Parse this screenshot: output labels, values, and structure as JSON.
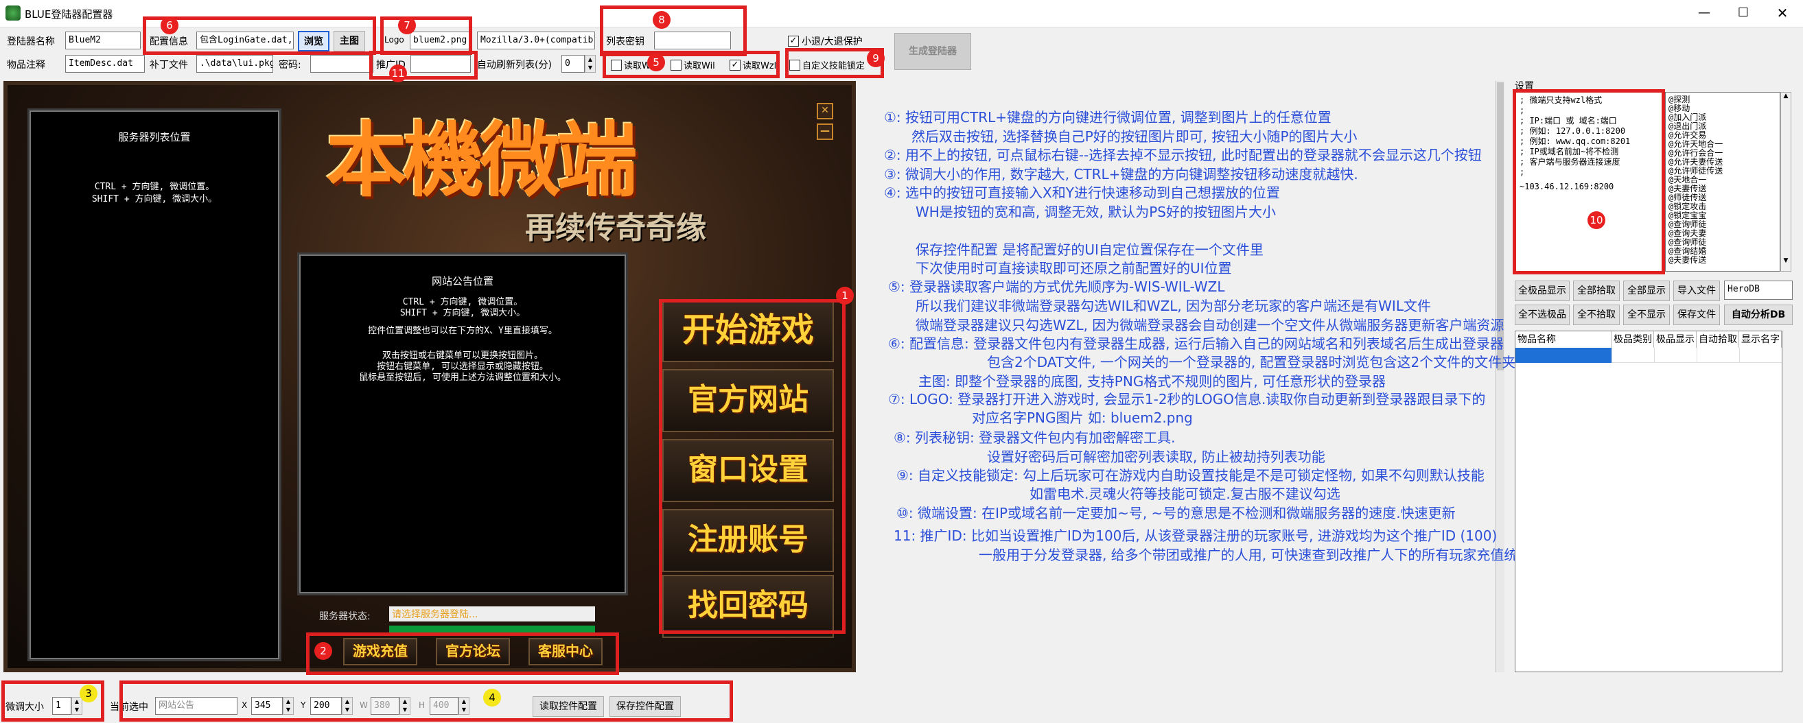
{
  "window": {
    "title": "BLUE登陆器配置器"
  },
  "toolbar": {
    "launcher_name_label": "登陆器名称",
    "launcher_name_value": "BlueM2",
    "config_info_label": "配置信息",
    "config_info_value": "包含LoginGate.dat,",
    "browse_label": "浏览",
    "main_image_label": "主图",
    "logo_label": "Logo",
    "logo_value": "bluem2.png",
    "useragent_value": "Mozilla/3.0+(compatible",
    "list_key_label": "列表密钥",
    "list_key_value": "",
    "small_retreat_label": "小退/大退保护",
    "generate_label": "生成登陆器",
    "item_note_label": "物品注释",
    "item_note_value": "ItemDesc.dat",
    "patch_file_label": "补丁文件",
    "patch_file_value": ".\\data\\lui.pkg",
    "password_label": "密码:",
    "password_value": "",
    "promo_id_label": "推广ID",
    "promo_id_value": "",
    "auto_refresh_label": "自动刷新列表(分)",
    "auto_refresh_value": "0",
    "read_wis_label": "读取Wis",
    "read_wil_label": "读取Wil",
    "read_wzl_label": "读取Wzl",
    "custom_skill_lock_label": "自定义技能锁定"
  },
  "badges": {
    "b1": "1",
    "b2": "2",
    "b3": "3",
    "b4": "4",
    "b5": "5",
    "b6": "6",
    "b7": "7",
    "b8": "8",
    "b9": "9",
    "b10": "10",
    "b11": "11"
  },
  "preview": {
    "logo_main": "本機微端",
    "logo_sub": "再续传奇奇缘",
    "server_list_title": "服务器列表位置",
    "server_list_hint1": "CTRL + 方向键, 微调位置。",
    "server_list_hint2": "SHIFT + 方向键,  微调大小。",
    "notice_title": "网站公告位置",
    "notice_hint1": "CTRL + 方向键, 微调位置。",
    "notice_hint2": "SHIFT + 方向键,  微调大小。",
    "notice_hint3": "控件位置调整也可以在下方的X、Y里直接填写。",
    "notice_hint4": "双击按钮或右键菜单可以更换按钮图片。",
    "notice_hint5": "按钮右键菜单, 可以选择显示或隐藏按钮。",
    "notice_hint6": "鼠标悬至按钮后, 可使用上述方法调整位置和大小。",
    "btn_start": "开始游戏",
    "btn_website": "官方网站",
    "btn_window": "窗口设置",
    "btn_register": "注册账号",
    "btn_recover": "找回密码",
    "server_status_label": "服务器状态:",
    "server_status_value": "请选择服务器登陆...",
    "btn_recharge": "游戏充值",
    "btn_forum": "官方论坛",
    "btn_service": "客服中心"
  },
  "instructions": [
    "①: 按钮可用CTRL+键盘的方向键进行微调位置, 调整到图片上的任意位置",
    "然后双击按钮, 选择替换自己P好的按钮图片即可, 按钮大小随P的图片大小",
    "②: 用不上的按钮, 可点鼠标右键--选择去掉不显示按钮, 此时配置出的登录器就不会显示这几个按钮",
    "③: 微调大小的作用, 数字越大, CTRL+键盘的方向键调整按钮移动速度就越快.",
    "④: 选中的按钮可直接输入X和Y进行快速移动到自己想摆放的位置",
    "WH是按钮的宽和高, 调整无效, 默认为PS好的按钮图片大小",
    "保存控件配置 是将配置好的UI自定位置保存在一个文件里",
    "下次使用时可直接读取即可还原之前配置好的UI位置",
    "⑤: 登录器读取客户端的方式优先顺序为-WIS-WIL-WZL",
    "所以我们建议非微端登录器勾选WIL和WZL, 因为部分老玩家的客户端还是有WIL文件",
    "微端登录器建议只勾选WZL, 因为微端登录器会自动创建一个空文件从微端服务器更新客户端资源",
    "⑥: 配置信息: 登录器文件包内有登录器生成器, 运行后输入自己的网站域名和列表域名后生成出登录器",
    "包含2个DAT文件, 一个网关的一个登录器的, 配置登录器时浏览包含这2个文件的文件夹即可",
    "主图: 即整个登录器的底图, 支持PNG格式不规则的图片, 可任意形状的登录器",
    "⑦: LOGO: 登录器打开进入游戏时, 会显示1-2秒的LOGO信息.读取你自动更新到登录器跟目录下的",
    "对应名字PNG图片   如: bluem2.png",
    "⑧: 列表秘钥: 登录器文件包内有加密解密工具.",
    "设置好密码后可解密加密列表读取, 防止被劫持列表功能",
    "⑨: 自定义技能锁定: 勾上后玩家可在游戏内自助设置技能是不是可锁定怪物, 如果不勾则默认技能",
    "如雷电术.灵魂火符等技能可锁定.复古服不建议勾选",
    "⑩: 微端设置: 在IP或域名前一定要加~号, ~号的意思是不检测和微端服务器的速度.快速更新",
    "11: 推广ID: 比如当设置推广ID为100后, 从该登录器注册的玩家账号, 进游戏均为这个推广ID (100)",
    "一般用于分发登录器, 给多个带团或推广的人用, 可快速查到改推广人下的所有玩家充值统计"
  ],
  "settings": {
    "title": "设置",
    "memo_lines": [
      "; 微端只支持wzl格式",
      ";",
      "; IP:端口 或 域名:端口",
      "; 例如: 127.0.0.1:8200",
      "; 例如: www.qq.com:8201",
      "; IP或域名前加~将不检测",
      "; 客户端与服务器连接速度",
      ";",
      "~103.46.12.169:8200"
    ],
    "list_items": [
      "@探测",
      "@移动",
      "@加入门派",
      "@退出门派",
      "@允许交易",
      "@允许天地合一",
      "@允许行会合一",
      "@允许夫妻传送",
      "@允许师徒传送",
      "@天地合一",
      "@夫妻传送",
      "@师徒传送",
      "@锁定攻击",
      "@锁定宝宝",
      "@查询师徒",
      "@查询夫妻",
      "@查询师徒",
      "@查询结婚",
      "@夫妻传送"
    ],
    "btn_all_show": "全极品显示",
    "btn_all_pick": "全部拾取",
    "btn_all_display": "全部显示",
    "btn_import": "导入文件",
    "db_value": "HeroDB",
    "btn_none_show": "全不选极品",
    "btn_none_pick": "全不拾取",
    "btn_none_display": "全不显示",
    "btn_save_file": "保存文件",
    "btn_auto_analyze": "自动分析DB",
    "table_headers": [
      "物品名称",
      "极品类别",
      "极品显示",
      "自动拾取",
      "显示名字"
    ]
  },
  "bottom": {
    "micro_size_label": "微调大小",
    "micro_size_value": "1",
    "current_selected_label": "当前选中",
    "current_selected_value": "网站公告",
    "x_label": "X",
    "x_value": "345",
    "y_label": "Y",
    "y_value": "200",
    "w_label": "W",
    "w_value": "380",
    "h_label": "H",
    "h_value": "400",
    "load_config_label": "读取控件配置",
    "save_config_label": "保存控件配置"
  }
}
